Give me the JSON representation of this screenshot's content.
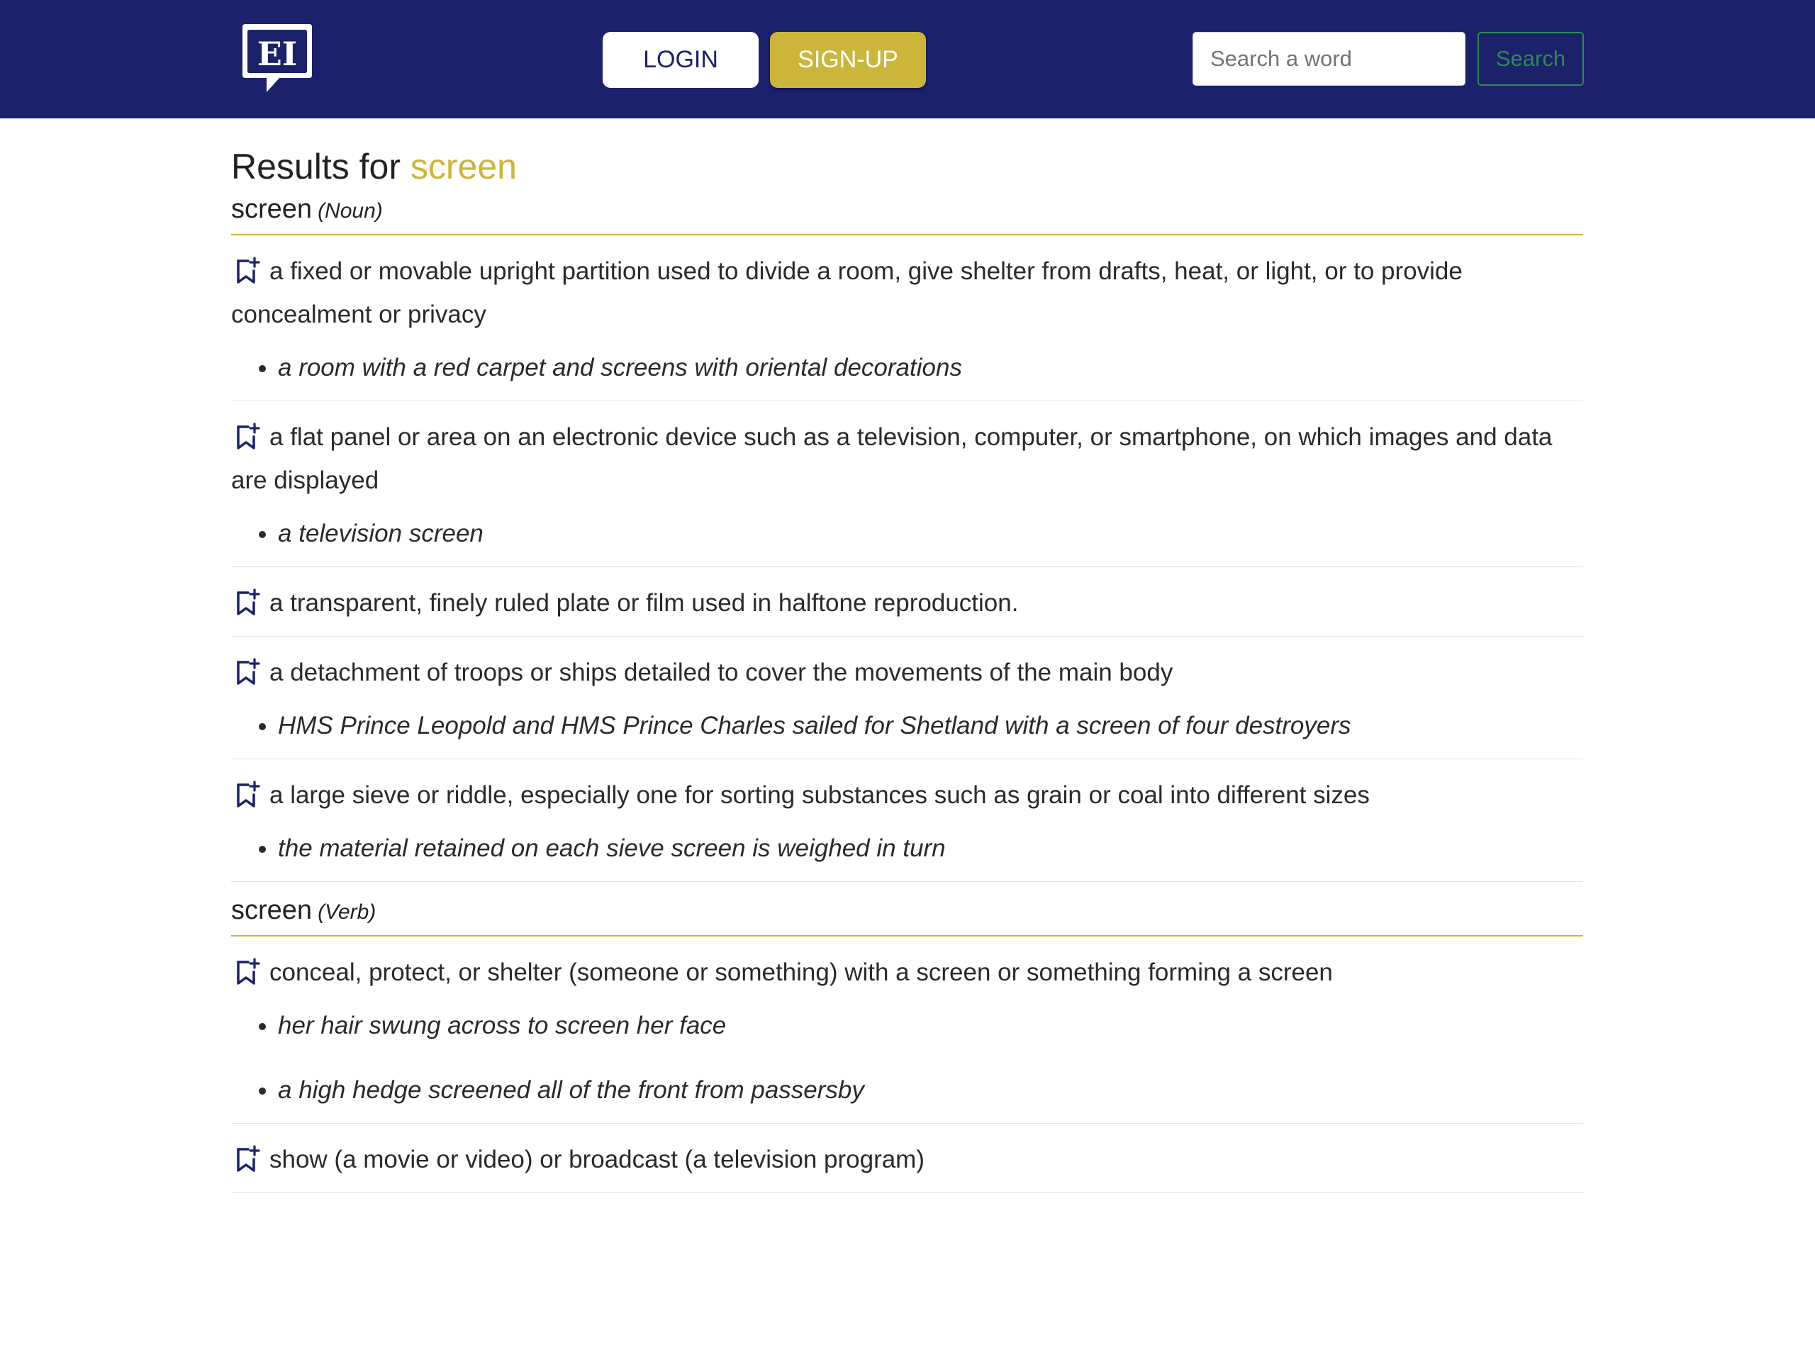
{
  "header": {
    "logo_text": "EI",
    "login_label": "LOGIN",
    "signup_label": "SIGN-UP",
    "search_placeholder": "Search a word",
    "search_button": "Search"
  },
  "colors": {
    "brand_navy": "#1b216a",
    "accent_gold": "#cbb63b",
    "search_green": "#2f8a55"
  },
  "results": {
    "prefix": "Results for",
    "term": "screen"
  },
  "entries": [
    {
      "word": "screen",
      "pos": "(Noun)",
      "senses": [
        {
          "definition": "a fixed or movable upright partition used to divide a room, give shelter from drafts, heat, or light, or to provide concealment or privacy",
          "examples": [
            "a room with a red carpet and screens with oriental decorations"
          ]
        },
        {
          "definition": "a flat panel or area on an electronic device such as a television, computer, or smartphone, on which images and data are displayed",
          "examples": [
            "a television screen"
          ]
        },
        {
          "definition": "a transparent, finely ruled plate or film used in halftone reproduction.",
          "examples": []
        },
        {
          "definition": "a detachment of troops or ships detailed to cover the movements of the main body",
          "examples": [
            "HMS Prince Leopold and HMS Prince Charles sailed for Shetland with a screen of four destroyers"
          ]
        },
        {
          "definition": "a large sieve or riddle, especially one for sorting substances such as grain or coal into different sizes",
          "examples": [
            "the material retained on each sieve screen is weighed in turn"
          ]
        }
      ]
    },
    {
      "word": "screen",
      "pos": "(Verb)",
      "senses": [
        {
          "definition": "conceal, protect, or shelter (someone or something) with a screen or something forming a screen",
          "examples": [
            "her hair swung across to screen her face",
            "a high hedge screened all of the front from passersby"
          ]
        },
        {
          "definition": "show (a movie or video) or broadcast (a television program)",
          "examples": []
        }
      ]
    }
  ],
  "icons": {
    "logo": "speech-bubble-logo-icon",
    "bookmark": "bookmark-add-icon"
  }
}
